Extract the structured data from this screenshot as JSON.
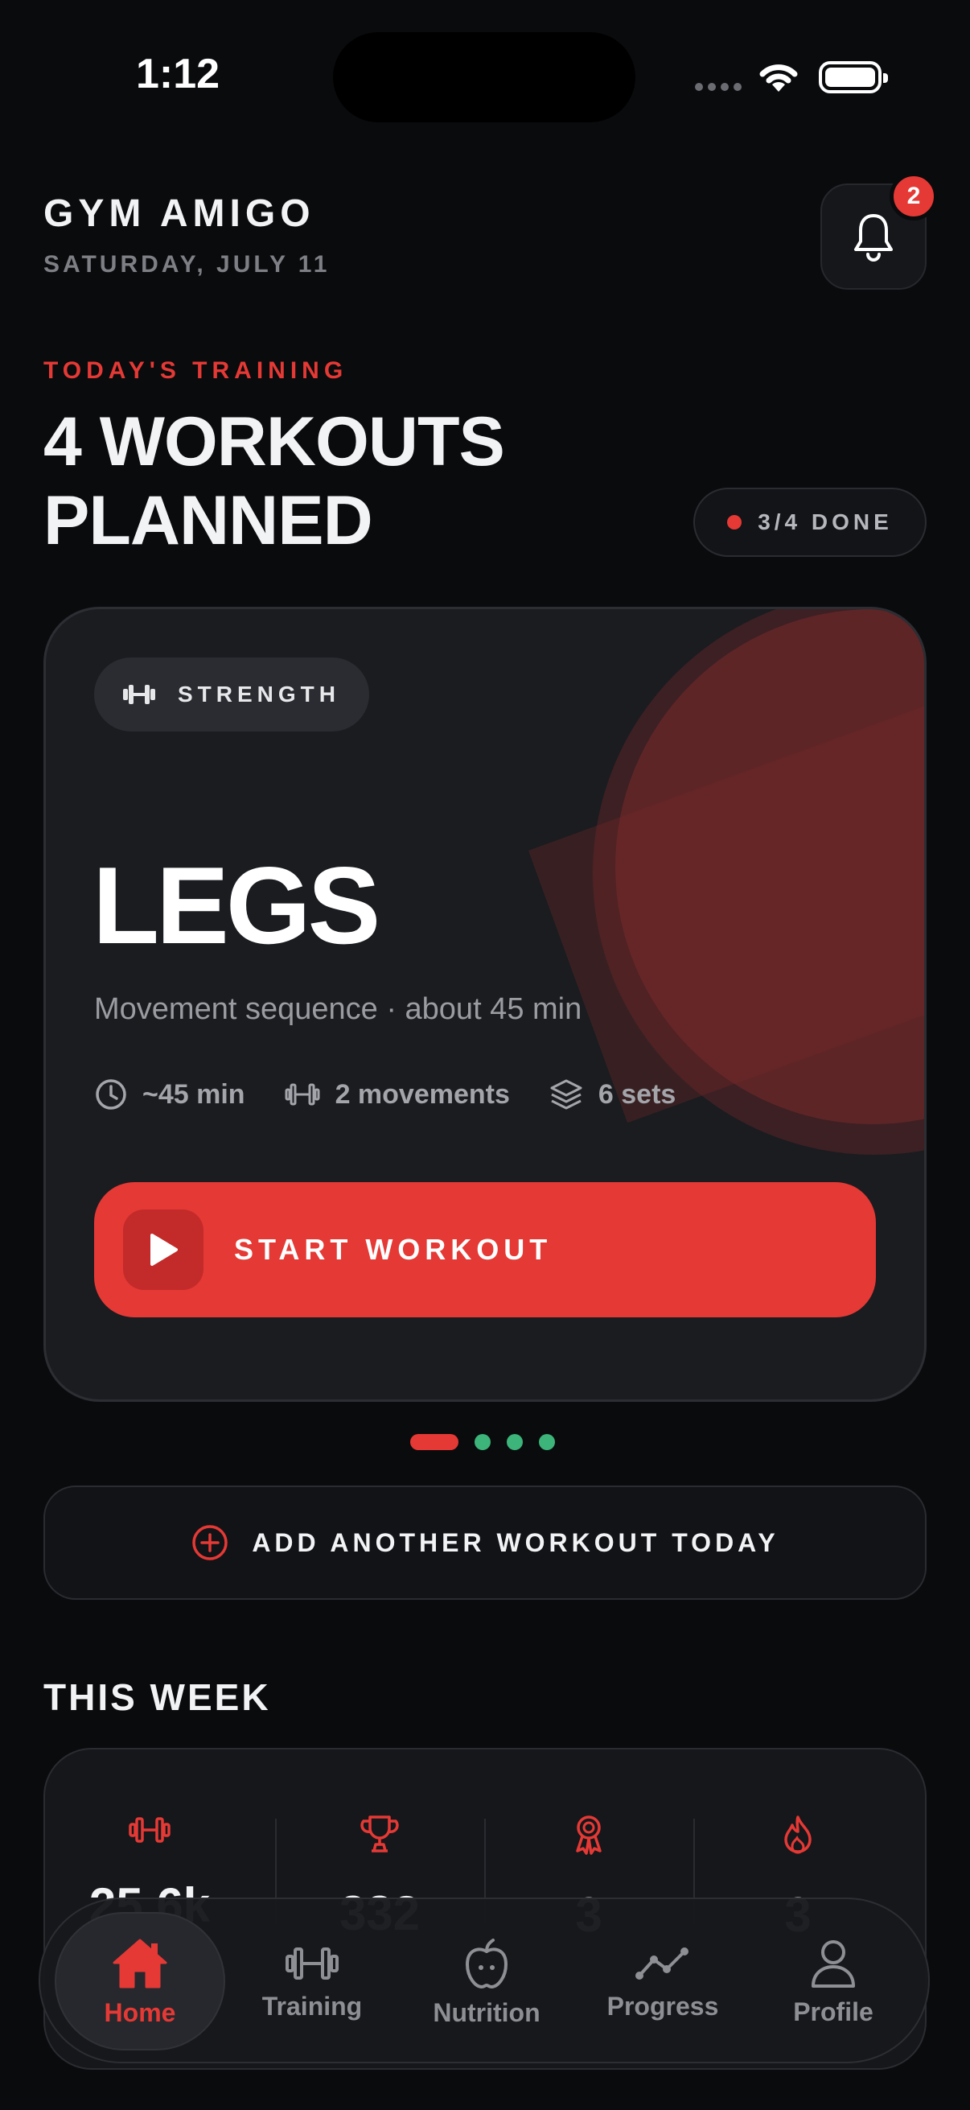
{
  "status_bar": {
    "time": "1:12"
  },
  "header": {
    "title": "GYM AMIGO",
    "date": "SATURDAY, JULY 11",
    "notification_count": "2"
  },
  "today": {
    "eyebrow": "TODAY'S TRAINING",
    "headline": "4 WORKOUTS PLANNED",
    "done_label": "3/4 DONE"
  },
  "workout_card": {
    "tag": "STRENGTH",
    "title": "LEGS",
    "subtitle": "Movement sequence · about 45 min",
    "duration": "~45 min",
    "movements": "2 movements",
    "sets": "6 sets",
    "start_label": "START WORKOUT"
  },
  "carousel": {
    "total": 4,
    "active_index": 0
  },
  "add_workout_label": "ADD ANOTHER WORKOUT TODAY",
  "this_week": {
    "title": "THIS WEEK",
    "stats": [
      {
        "icon": "dumbbell-icon",
        "value": "25.6k"
      },
      {
        "icon": "trophy-icon",
        "value": "332"
      },
      {
        "icon": "medal-icon",
        "value": "3"
      },
      {
        "icon": "flame-icon",
        "value": "3"
      }
    ]
  },
  "tab_bar": {
    "items": [
      {
        "label": "Home",
        "icon": "home-icon",
        "active": true
      },
      {
        "label": "Training",
        "icon": "dumbbell-icon",
        "active": false
      },
      {
        "label": "Nutrition",
        "icon": "apple-icon",
        "active": false
      },
      {
        "label": "Progress",
        "icon": "chart-line-icon",
        "active": false
      },
      {
        "label": "Profile",
        "icon": "user-icon",
        "active": false
      }
    ]
  },
  "colors": {
    "accent": "#e53935",
    "background": "#0a0b0d",
    "card": "#1a1c20",
    "dot_inactive": "#3cb47a"
  }
}
